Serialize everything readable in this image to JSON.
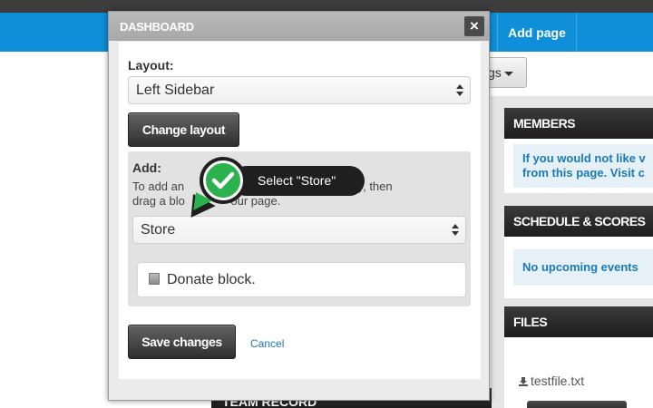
{
  "navbar": {
    "add_page_label": "Add page"
  },
  "settings_button": {
    "label_visible": "gs"
  },
  "members": {
    "title": "MEMBERS",
    "note_line1": "If you would not like v",
    "note_line2": "from this page. Visit c"
  },
  "schedule": {
    "title": "SCHEDULE & SCORES",
    "note": "No upcoming events"
  },
  "files": {
    "title": "FILES",
    "items": [
      "testfile.txt"
    ]
  },
  "team_record": {
    "title": "TEAM RECORD"
  },
  "modal": {
    "title": "DASHBOARD",
    "close_glyph": "×",
    "layout_label": "Layout:",
    "layout_value": "Left Sidebar",
    "change_layout_label": "Change layout",
    "add_label": "Add:",
    "add_help_line1": "To add an                                      a category, then",
    "add_help_line2": "drag a blo              our page.",
    "category_value": "Store",
    "block_label": "Donate block.",
    "save_label": "Save changes",
    "cancel_label": "Cancel"
  },
  "tooltip": {
    "text": "Select \"Store\""
  },
  "colors": {
    "nav_blue": "#0e8fd8",
    "link_blue": "#1b79b8",
    "check_green": "#2bb24c"
  }
}
